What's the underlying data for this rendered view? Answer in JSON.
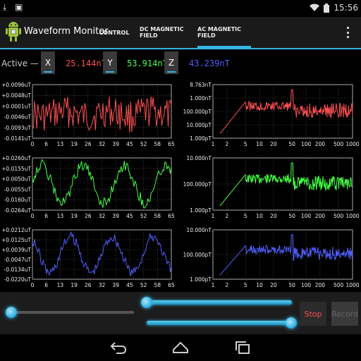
{
  "status_bar": {
    "clock": "15:56",
    "icons_left": [
      "download-icon",
      "image-icon"
    ],
    "icons_right": [
      "wifi-icon",
      "battery-icon"
    ]
  },
  "action_bar": {
    "title": "Waveform Monitor",
    "tabs": [
      {
        "label": "CONTROL",
        "selected": false
      },
      {
        "label": "DC MAGNETIC FIELD",
        "selected": false
      },
      {
        "label": "AC MAGNETIC FIELD",
        "selected": true
      }
    ],
    "overflow_icon": "overflow-menu-icon"
  },
  "channels": {
    "active_label": "Active —",
    "x": {
      "key": "X",
      "value": "25.144nT",
      "color": "#ff5050"
    },
    "y": {
      "key": "Y",
      "value": "53.914nT",
      "color": "#44ff44"
    },
    "z": {
      "key": "Z",
      "value": "43.239nT",
      "color": "#5060ff"
    }
  },
  "time_plots": {
    "x_ticks": [
      "0",
      "6",
      "13",
      "19",
      "26",
      "32",
      "39",
      "45",
      "52",
      "58",
      "65"
    ],
    "x": {
      "y_ticks": [
        "+0.0096uT",
        "+0.0048uT",
        "+0.0001uT",
        "-0.0046uT",
        "-0.0093uT",
        "-0.0141uT"
      ]
    },
    "y": {
      "y_ticks": [
        "+0.0260uT",
        "+0.0155uT",
        "+0.0050uT",
        "-0.0055uT",
        "-0.0160uT",
        "-0.0264uT"
      ]
    },
    "z": {
      "y_ticks": [
        "+0.0212uT",
        "+0.0125uT",
        "+0.0039uT",
        "-0.0047uT",
        "-0.0134uT",
        "-0.0220uT"
      ]
    }
  },
  "spectrum_plots": {
    "x_ticks": [
      "1",
      "2",
      "5",
      "10",
      "20",
      "50",
      "100",
      "200",
      "500",
      "1000"
    ],
    "x": {
      "y_ticks": [
        "8.763nT",
        "1.000nT",
        "100.000pT",
        "10.000pT",
        "1.000pT"
      ]
    },
    "y": {
      "y_ticks": [
        "10.000nT",
        "100.000pT",
        "1.000pT"
      ]
    },
    "z": {
      "y_ticks": [
        "10.000nT",
        "100.000pT",
        "1.000pT"
      ]
    }
  },
  "controls": {
    "stop_label": "Stop",
    "record_label": "Record",
    "left_slider_level": 0.0,
    "top_slider_level": 0.0,
    "bottom_slider_level": 1.0
  },
  "nav_bar": {
    "back": "back-icon",
    "home": "home-icon",
    "recents": "recents-icon"
  },
  "colors": {
    "accent": "#33b5e5",
    "grid": "#666666",
    "plot_bg": "#ffffff"
  }
}
